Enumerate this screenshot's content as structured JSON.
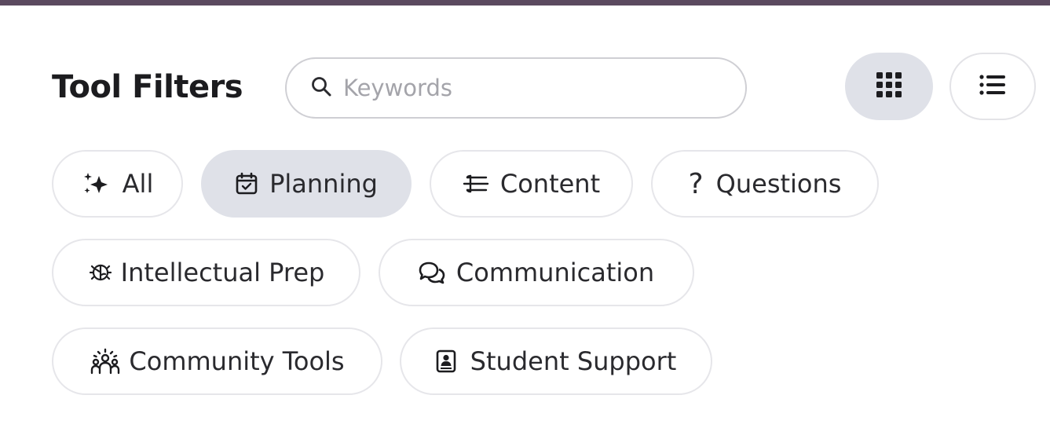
{
  "header": {
    "title": "Tool Filters"
  },
  "search": {
    "placeholder": "Keywords",
    "value": "",
    "icon": "search-icon"
  },
  "view_toggle": {
    "selected": "grid",
    "options": [
      {
        "id": "grid",
        "icon": "grid-view-icon"
      },
      {
        "id": "list",
        "icon": "list-view-icon"
      }
    ]
  },
  "filters": [
    {
      "label": "All",
      "icon": "sparkles-icon",
      "active": false
    },
    {
      "label": "Planning",
      "icon": "calendar-check-icon",
      "active": true
    },
    {
      "label": "Content",
      "icon": "layers-content-icon",
      "active": false
    },
    {
      "label": "Questions",
      "icon": "question-mark-icon",
      "active": false
    },
    {
      "label": "Intellectual Prep",
      "icon": "brain-icon",
      "active": false
    },
    {
      "label": "Communication",
      "icon": "chat-bubbles-icon",
      "active": false
    },
    {
      "label": "Community Tools",
      "icon": "community-people-icon",
      "active": false
    },
    {
      "label": "Student Support",
      "icon": "student-badge-icon",
      "active": false
    }
  ],
  "colors": {
    "active_chip_bg": "#dfe1e8",
    "chip_border": "#e6e6ea",
    "top_bar": "#5b4a5f",
    "text": "#1c1c1f",
    "placeholder": "#a4a4aa"
  }
}
